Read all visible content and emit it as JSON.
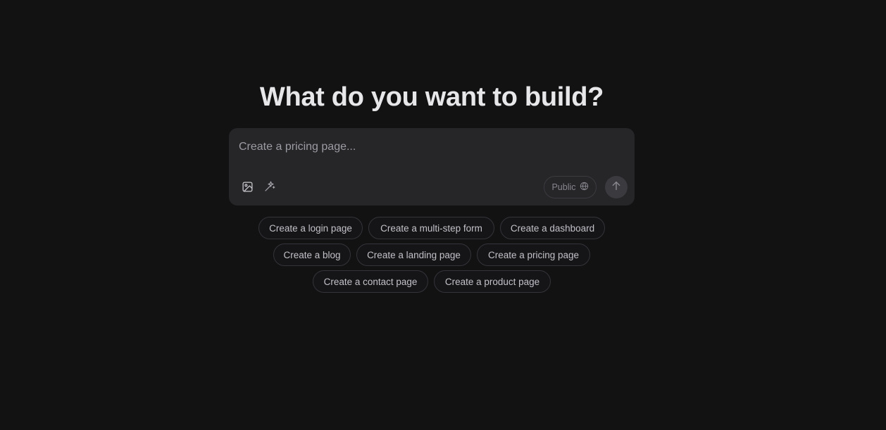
{
  "heading": "What do you want to build?",
  "composer": {
    "placeholder": "Create a pricing page...",
    "visibility_label": "Public"
  },
  "icons": {
    "attach": "image-icon",
    "enhance": "sparkles-wand-icon",
    "visibility": "globe-icon",
    "send": "arrow-up-icon"
  },
  "suggestions": [
    "Create a login page",
    "Create a multi-step form",
    "Create a dashboard",
    "Create a blog",
    "Create a landing page",
    "Create a pricing page",
    "Create a contact page",
    "Create a product page"
  ]
}
